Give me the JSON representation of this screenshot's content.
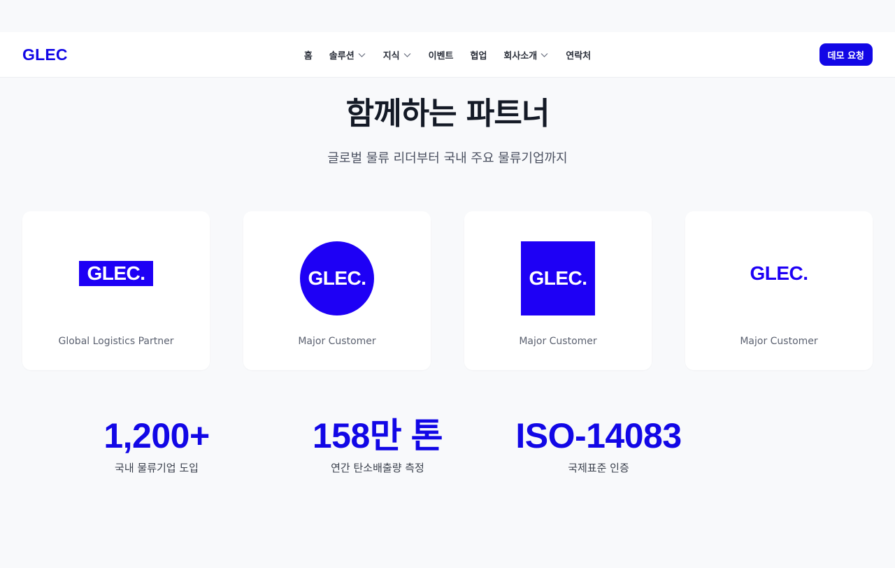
{
  "header": {
    "logo": "GLEC",
    "nav": [
      {
        "label": "홈",
        "dropdown": false
      },
      {
        "label": "솔루션",
        "dropdown": true
      },
      {
        "label": "지식",
        "dropdown": true
      },
      {
        "label": "이벤트",
        "dropdown": false
      },
      {
        "label": "협업",
        "dropdown": false
      },
      {
        "label": "회사소개",
        "dropdown": true
      },
      {
        "label": "연락처",
        "dropdown": false
      }
    ],
    "cta": "데모 요청"
  },
  "partners": {
    "title": "함께하는 파트너",
    "subtitle": "글로벌 물류 리더부터 국내 주요 물류기업까지",
    "cards": [
      {
        "logo_text": "GLEC.",
        "logo_style": "banner",
        "label": "Global Logistics Partner"
      },
      {
        "logo_text": "GLEC.",
        "logo_style": "circle",
        "label": "Major Customer"
      },
      {
        "logo_text": "GLEC.",
        "logo_style": "square",
        "label": "Major Customer"
      },
      {
        "logo_text": "GLEC.",
        "logo_style": "plain",
        "label": "Major Customer"
      }
    ]
  },
  "stats": [
    {
      "value": "1,200+",
      "label": "국내 물류기업 도입"
    },
    {
      "value": "158만 톤",
      "label": "연간 탄소배출량 측정"
    },
    {
      "value": "ISO-14083",
      "label": "국제표준 인증"
    }
  ],
  "colors": {
    "brand": "#1207e6",
    "logo_fill": "#1e00f5",
    "background": "#f8f9fb"
  }
}
